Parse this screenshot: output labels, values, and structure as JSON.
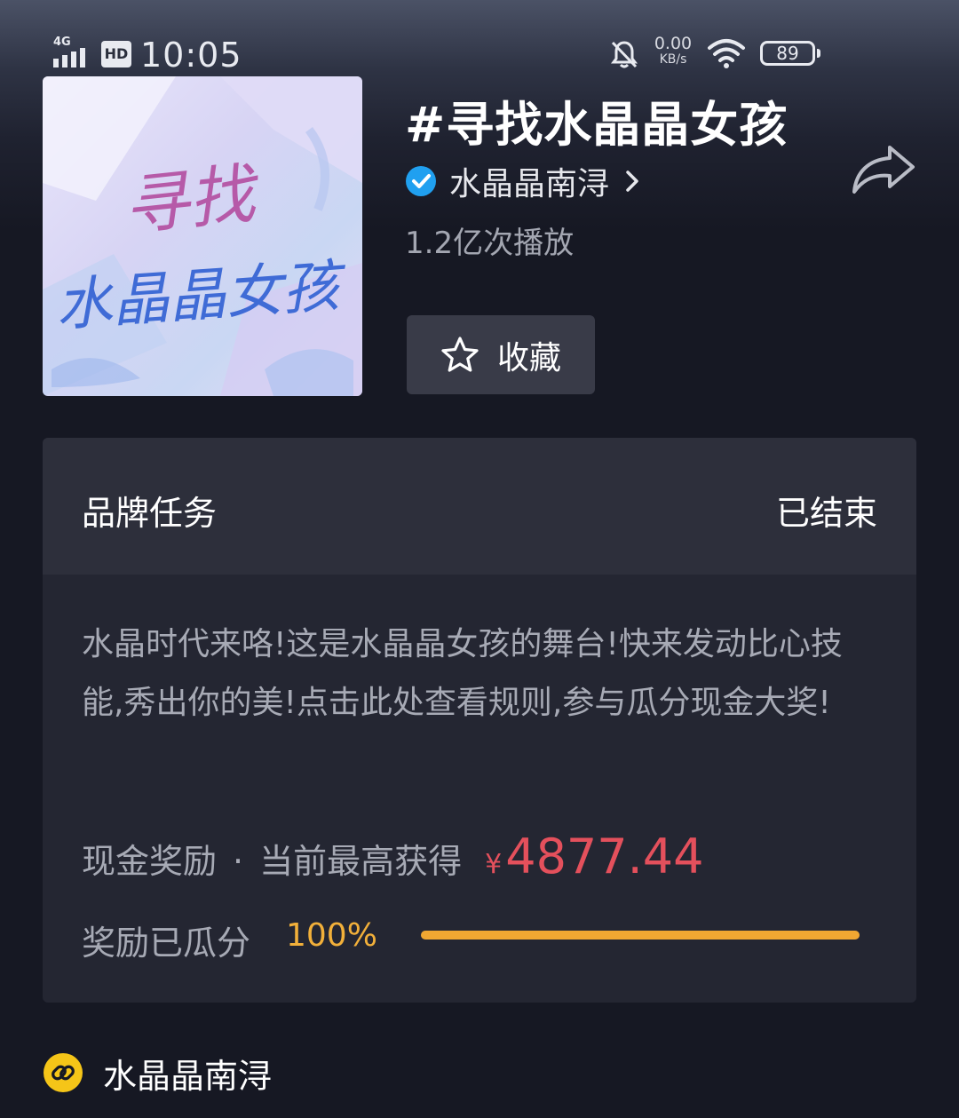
{
  "status_bar": {
    "network": "4G",
    "hd": "HD",
    "time": "10:05",
    "speed_value": "0.00",
    "speed_unit": "KB/s",
    "battery": "89"
  },
  "header": {
    "title": "#寻找水晶晶女孩",
    "creator_name": "水晶晶南浔",
    "plays": "1.2亿次播放",
    "favorite_label": "收藏"
  },
  "cover": {
    "text_line1": "寻找",
    "text_line2": "水晶晶女孩"
  },
  "task_card": {
    "title": "品牌任务",
    "status": "已结束",
    "description": "水晶时代来咯!这是水晶晶女孩的舞台!快来发动比心技能,秀出你的美!点击此处查看规则,参与瓜分现金大奖!",
    "cash_label": "现金奖励",
    "dot": "·",
    "cash_sub": "当前最高获得",
    "currency": "¥",
    "cash_amount": "4877.44",
    "progress_label": "奖励已瓜分",
    "progress_percent": "100%",
    "progress_fraction": 1.0
  },
  "footer": {
    "link_name": "水晶晶南浔"
  },
  "colors": {
    "background": "#161823",
    "card": "#242632",
    "accent_red": "#e4505c",
    "accent_orange": "#f0a732",
    "verified_blue": "#20a0f0",
    "link_yellow": "#f5c518"
  },
  "icons": [
    "bell-off-icon",
    "wifi-icon",
    "verified-icon",
    "chevron-right-icon",
    "share-icon",
    "star-icon",
    "link-icon"
  ]
}
